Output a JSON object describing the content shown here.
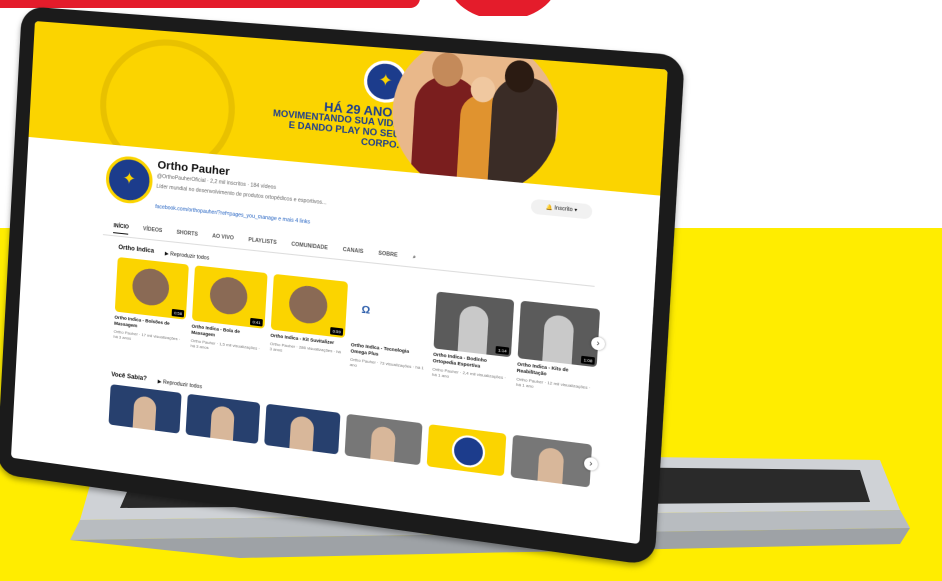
{
  "colors": {
    "brand_yellow": "#ffed00",
    "brand_blue": "#1c3c8c",
    "accent_red": "#e41c2b"
  },
  "banner": {
    "line1": "HÁ 29 ANOS",
    "line2": "MOVIMENTANDO SUA VIDA",
    "line3": "E DANDO PLAY NO SEU CORPO."
  },
  "channel": {
    "name": "Ortho Pauher",
    "meta": "@OrthoPauherOficial · 2,2 mil inscritos · 184 vídeos",
    "description": "Líder mundial no desenvolvimento de produtos ortopédicos e esportivos...",
    "link": "facebook.com/orthopauher/?ref=pages_you_manage e mais 4 links",
    "subscribe_label": "Inscrito"
  },
  "tabs": [
    "INÍCIO",
    "VÍDEOS",
    "SHORTS",
    "AO VIVO",
    "PLAYLISTS",
    "COMUNIDADE",
    "CANAIS",
    "SOBRE"
  ],
  "section1": {
    "title": "Ortho Indica",
    "play_all": "Reproduzir todos",
    "videos": [
      {
        "title": "Ortho Indica - Bolsões de Massagem",
        "meta": "Ortho Pauher · 17 mil visualizações · há 3 anos",
        "duration": "0:58"
      },
      {
        "title": "Ortho Indica - Bola de Massagem",
        "meta": "Ortho Pauher · 1,5 mil visualizações · há 3 anos",
        "duration": "0:41"
      },
      {
        "title": "Ortho Indica - Kit Suvitalizer",
        "meta": "Ortho Pauher · 286 visualizações · há 3 anos",
        "duration": "0:59"
      },
      {
        "title": "Ortho Indica - Tecnologia Omega Plus",
        "meta": "Ortho Pauher · 73 visualizações · há 1 ano",
        "duration": ""
      },
      {
        "title": "Ortho Indica - Bodinho Ortopedia Esportiva",
        "meta": "Ortho Pauher · 2,4 mil visualizações · há 1 ano",
        "duration": "1:14"
      },
      {
        "title": "Ortho Indica - Kits de Reabilitação",
        "meta": "Ortho Pauher · 12 mil visualizações · há 1 ano",
        "duration": "1:08"
      }
    ]
  },
  "section2": {
    "title": "Você Sabia?",
    "play_all": "Reproduzir todos"
  }
}
